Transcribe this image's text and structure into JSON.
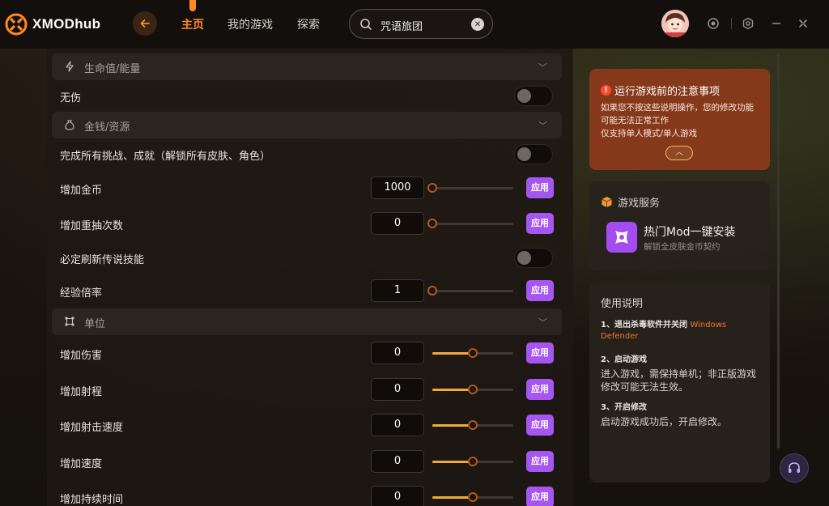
{
  "app": {
    "logo_text": "XMODhub",
    "nav": [
      "主页",
      "我的游戏",
      "探索"
    ],
    "search": {
      "value": "咒语旅团"
    }
  },
  "sections": {
    "energy": {
      "label": "生命值/能量"
    },
    "money": {
      "label": "金钱/资源"
    },
    "unit": {
      "label": "单位"
    }
  },
  "rows": {
    "invincible": {
      "label": "无伤"
    },
    "complete_all": {
      "label": "完成所有挑战、成就（解锁所有皮肤、角色）"
    },
    "add_gold": {
      "label": "增加金币",
      "value": "1000",
      "slider": 0
    },
    "add_reroll": {
      "label": "增加重抽次数",
      "value": "0",
      "slider": 0
    },
    "legendary": {
      "label": "必定刷新传说技能"
    },
    "exp_rate": {
      "label": "经验倍率",
      "value": "1",
      "slider": 0
    },
    "add_damage": {
      "label": "增加伤害",
      "value": "0",
      "slider": 0.5
    },
    "add_range": {
      "label": "增加射程",
      "value": "0",
      "slider": 0.5
    },
    "add_firerate": {
      "label": "增加射击速度",
      "value": "0",
      "slider": 0.5
    },
    "add_speed": {
      "label": "增加速度",
      "value": "0",
      "slider": 0.5
    },
    "add_duration": {
      "label": "增加持续时间",
      "value": "0",
      "slider": 0.5
    }
  },
  "apply_label": "应用",
  "notice": {
    "title": "运行游戏前的注意事项",
    "line1": "如果您不按这些说明操作，您的修改功能",
    "line2": "可能无法正常工作",
    "line3": "仅支持单人模式/单人游戏"
  },
  "service": {
    "title": "游戏服务",
    "mod_title": "热门Mod一键安装",
    "mod_sub": "解锁全皮肤金币契约"
  },
  "guide": {
    "title": "使用说明",
    "step1_title": "1、退出杀毒软件并关闭",
    "step1_highlight_a": "Windows",
    "step1_highlight_b": "Defender",
    "step2_title": "2、启动游戏",
    "step2_body": "进入游戏，需保持单机；非正版游戏修改可能无法生效。",
    "step3_title": "3、开启修改",
    "step3_body": "启动游戏成功后，开启修改。"
  },
  "colors": {
    "accent": "#ff8a1e",
    "apply": "#a656f0",
    "notice": "#86391a"
  }
}
